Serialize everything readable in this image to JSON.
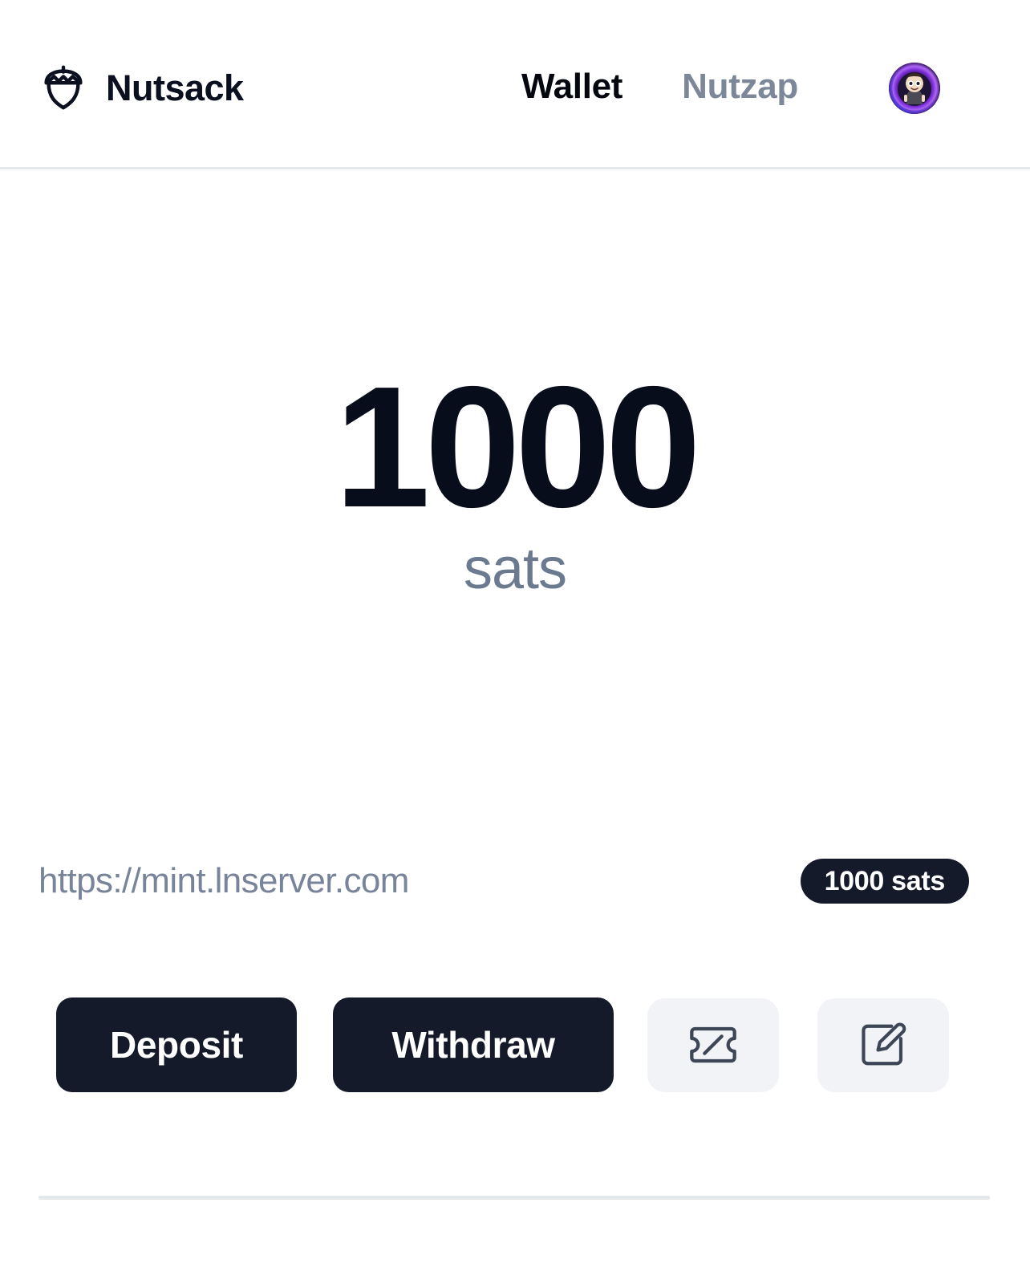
{
  "header": {
    "brand_name": "Nutsack",
    "brand_icon": "acorn-icon",
    "nav": [
      {
        "label": "Wallet",
        "state": "active"
      },
      {
        "label": "Nutzap",
        "state": "inactive"
      }
    ],
    "avatar": {
      "name": "user-avatar",
      "ring_outer_color": "#2B0B4A",
      "ring_mid_color": "#7A2BD6",
      "ring_inner_color": "#B06BF5",
      "ring_blue_color": "#3A3AE0"
    }
  },
  "balance": {
    "amount": "1000",
    "unit": "sats"
  },
  "mint": {
    "url": "https://mint.lnserver.com",
    "badge": "1000 sats"
  },
  "actions": {
    "deposit_label": "Deposit",
    "withdraw_label": "Withdraw",
    "token_icon": "ticket-icon",
    "edit_icon": "edit-square-icon"
  },
  "colors": {
    "ink": "#080D1C",
    "dark_surface": "#141A2A",
    "muted_text": "#77849A",
    "divider": "#E3E8ED",
    "icon_button_bg": "#F1F3F7",
    "background": "#FFFFFF"
  }
}
